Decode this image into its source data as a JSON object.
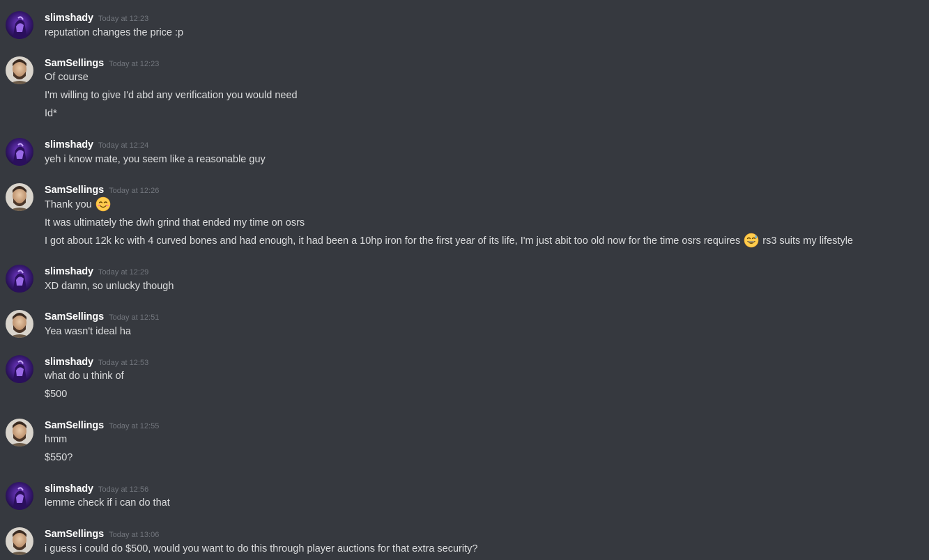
{
  "users": {
    "slim": "slimshady",
    "sam": "SamSellings"
  },
  "colors": {
    "background": "#36393f",
    "username": "#ffffff",
    "message_text": "#dcddde",
    "timestamp": "#72767d"
  },
  "messages": [
    {
      "user": "slimshady",
      "time": "Today at 12:23",
      "lines": [
        "reputation changes the price :p"
      ]
    },
    {
      "user": "SamSellings",
      "time": "Today at 12:23",
      "lines": [
        "Of course",
        "I'm willing to give I'd abd any verification you would need",
        "Id*"
      ]
    },
    {
      "user": "slimshady",
      "time": "Today at 12:24",
      "lines": [
        "yeh i know mate, you seem like a reasonable guy"
      ]
    },
    {
      "user": "SamSellings",
      "time": "Today at 12:26",
      "lines": [
        "Thank you",
        "It was ultimately the dwh grind that ended my time on osrs",
        "I got about 12k kc with 4 curved bones and had enough,  it had been a 10hp iron for the first year of its life,  I'm just abit too old now for the time osrs requires",
        "rs3 suits my lifestyle"
      ],
      "emojis": [
        "smiling-blush-emoji",
        "grinning-sweat-emoji"
      ]
    },
    {
      "user": "slimshady",
      "time": "Today at 12:29",
      "lines": [
        "XD damn, so unlucky though"
      ]
    },
    {
      "user": "SamSellings",
      "time": "Today at 12:51",
      "lines": [
        "Yea wasn't ideal ha"
      ]
    },
    {
      "user": "slimshady",
      "time": "Today at 12:53",
      "lines": [
        "what do u think of",
        "$500"
      ]
    },
    {
      "user": "SamSellings",
      "time": "Today at 12:55",
      "lines": [
        "hmm",
        "$550?"
      ]
    },
    {
      "user": "slimshady",
      "time": "Today at 12:56",
      "lines": [
        "lemme check if i can do that"
      ]
    },
    {
      "user": "SamSellings",
      "time": "Today at 13:06",
      "lines": [
        "i guess i could do $500, would you want to do this through player auctions for that extra security?"
      ]
    }
  ]
}
